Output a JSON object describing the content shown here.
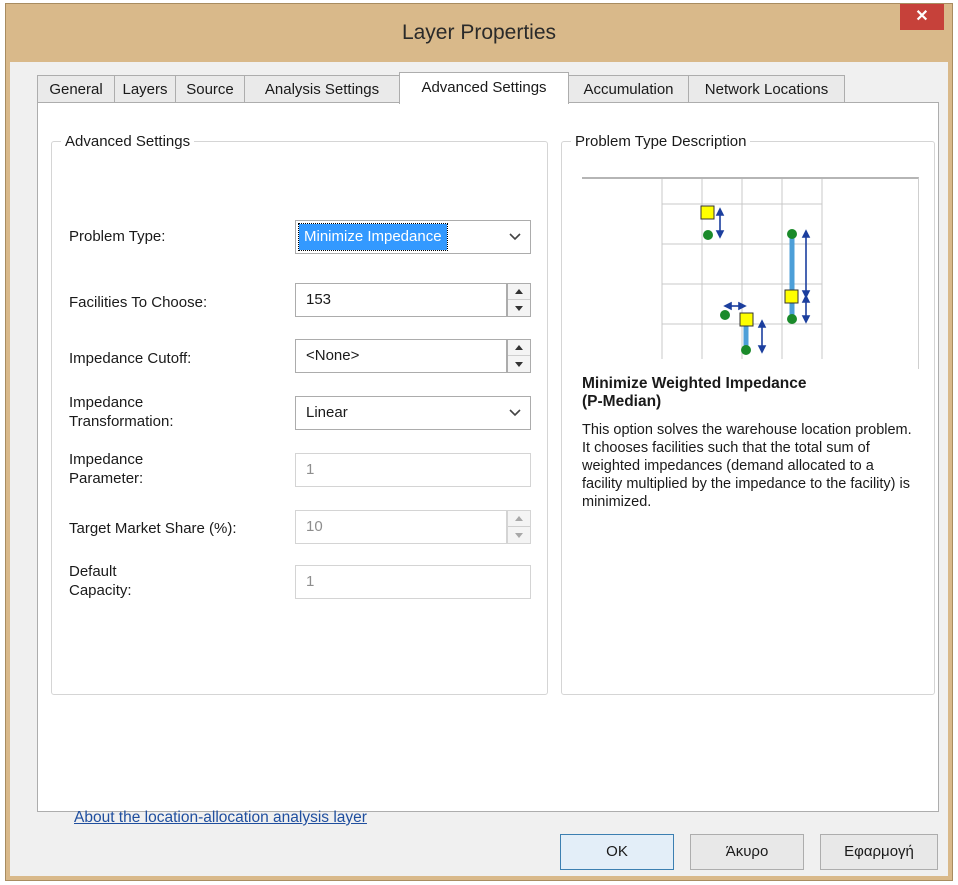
{
  "window": {
    "title": "Layer Properties"
  },
  "tabs": [
    {
      "label": "General"
    },
    {
      "label": "Layers"
    },
    {
      "label": "Source"
    },
    {
      "label": "Analysis Settings"
    },
    {
      "label": "Advanced Settings",
      "active": true
    },
    {
      "label": "Accumulation"
    },
    {
      "label": "Network Locations"
    }
  ],
  "advanced": {
    "legend": "Advanced Settings",
    "problem_type": {
      "label": "Problem Type:",
      "value": "Minimize Impedance"
    },
    "facilities": {
      "label": "Facilities To Choose:",
      "value": "153"
    },
    "cutoff": {
      "label": "Impedance Cutoff:",
      "value": "<None>"
    },
    "transformation": {
      "label_line1": "Impedance",
      "label_line2": "Transformation:",
      "value": "Linear"
    },
    "parameter": {
      "label_line1": "Impedance",
      "label_line2": "Parameter:",
      "value": "1"
    },
    "market_share": {
      "label": "Target Market Share (%):",
      "value": "10"
    },
    "capacity": {
      "label_line1": "Default",
      "label_line2": "Capacity:",
      "value": "1"
    }
  },
  "description": {
    "legend": "Problem Type Description",
    "title_line1": "Minimize Weighted Impedance",
    "title_line2": "(P-Median)",
    "text": "This option solves the warehouse location problem. It chooses facilities such that the total sum of weighted impedances (demand allocated to a facility multiplied by the impedance to the facility) is minimized."
  },
  "link": {
    "text": "About the location-allocation analysis layer"
  },
  "buttons": {
    "ok": "OK",
    "cancel": "Άκυρο",
    "apply": "Εφαρμογή"
  },
  "colors": {
    "titlebar": "#d9b98a",
    "close": "#c6413a",
    "selection": "#3399ff",
    "link": "#1f4e9e",
    "facility": "#ffff00",
    "demand": "#1a8a2a",
    "arrow": "#1c3f9e",
    "line": "#4d9fd8"
  },
  "icons": {
    "close": "close-icon",
    "dropdown": "chevron-down-icon",
    "spin_up": "arrow-up-icon",
    "spin_down": "arrow-down-icon"
  }
}
